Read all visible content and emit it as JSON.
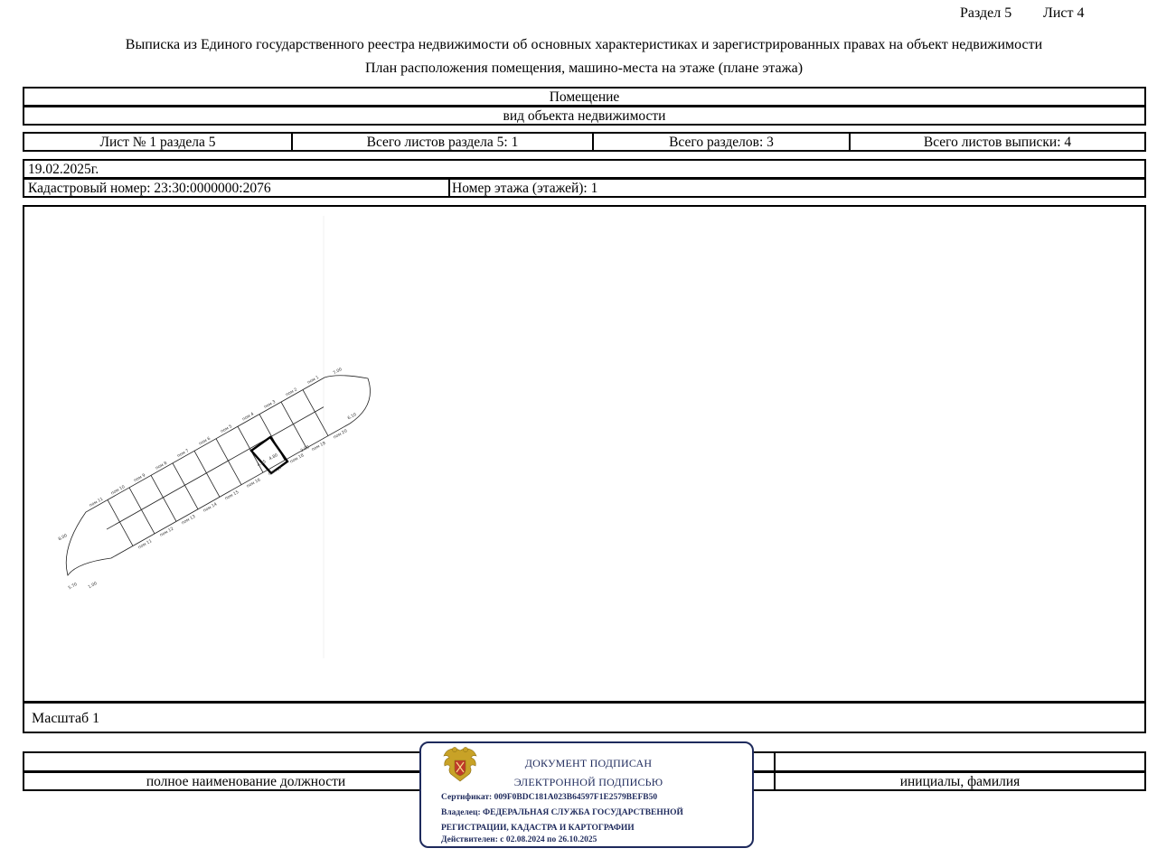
{
  "header": {
    "section": "Раздел 5",
    "sheet": "Лист 4",
    "title_line1": "Выписка из Единого государственного реестра недвижимости об основных характеристиках и зарегистрированных правах на объект недвижимости",
    "title_line2": "План расположения помещения, машино-места на этаже (плане этажа)"
  },
  "object": {
    "type_value": "Помещение",
    "type_caption": "вид объекта недвижимости"
  },
  "sheet_info": {
    "sheet_of_section": "Лист № 1 раздела 5",
    "total_section_sheets": "Всего листов раздела 5: 1",
    "total_sections": "Всего разделов: 3",
    "total_extract_sheets": "Всего листов выписки: 4"
  },
  "record": {
    "date": "19.02.2025г.",
    "cadastral_number": "Кадастровый номер: 23:30:0000000:2076",
    "floor_number": "Номер этажа (этажей): 1"
  },
  "plan": {
    "scale": "Масштаб 1",
    "room_labels_top": [
      "пом 1",
      "пом 2",
      "пом 3",
      "пом 4",
      "пом 5",
      "пом 6",
      "пом 7",
      "пом 8",
      "пом 9",
      "пом 10",
      "пом 11"
    ],
    "room_labels_bottom": [
      "пом 20",
      "пом 19",
      "пом 18",
      "пом 17",
      "пом 16",
      "пом 15",
      "пом 14",
      "пом 13",
      "пом 12",
      "пом 11"
    ],
    "dimension_labels": [
      "7.00",
      "6.10",
      "8.00",
      "5.70",
      "1.00",
      "2.00",
      "4.95",
      "4.80"
    ]
  },
  "signatures": {
    "position_caption": "полное наименование должности",
    "name_caption": "инициалы, фамилия"
  },
  "stamp": {
    "line1": "ДОКУМЕНТ ПОДПИСАН",
    "line2": "ЭЛЕКТРОННОЙ ПОДПИСЬЮ",
    "certificate": "Сертификат: 009F0BDC181A023B64597F1E2579BEFB50",
    "owner_line1": "Владелец: ФЕДЕРАЛЬНАЯ СЛУЖБА ГОСУДАРСТВЕННОЙ",
    "owner_line2": "РЕГИСТРАЦИИ, КАДАСТРА И КАРТОГРАФИИ",
    "valid": "Действителен: с 02.08.2024 по 26.10.2025",
    "emblem_color": "#c8a227",
    "shield_color": "#c0392b",
    "border_color": "#1e2a5c"
  }
}
